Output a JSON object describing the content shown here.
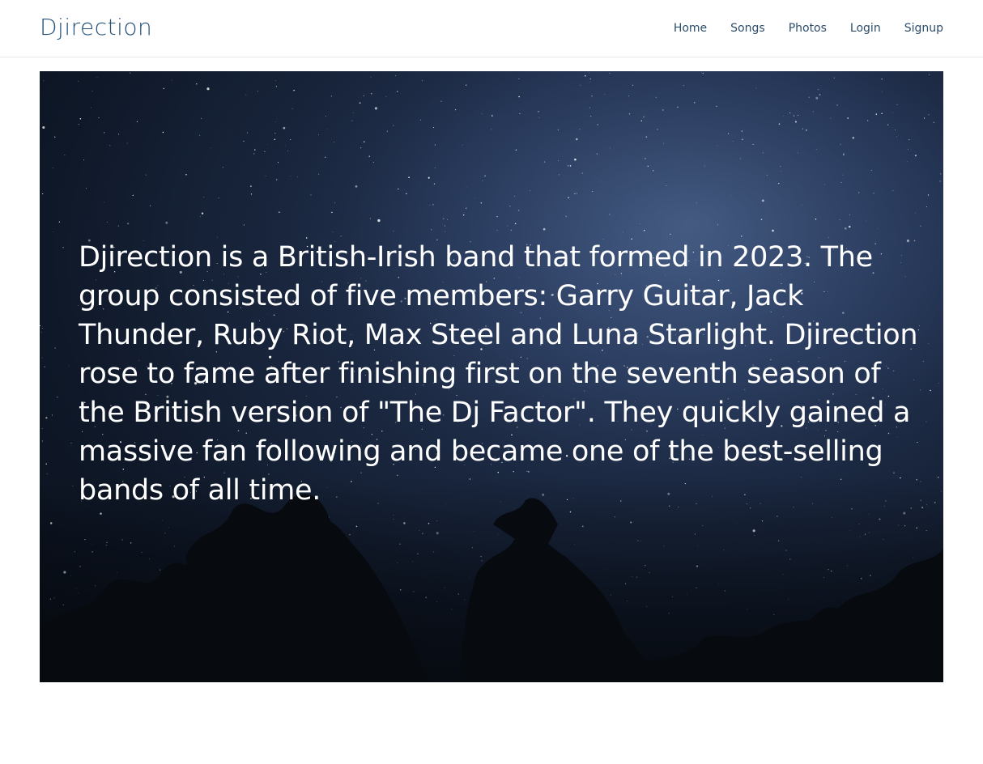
{
  "header": {
    "brand": "Djirection",
    "nav": [
      {
        "label": "Home"
      },
      {
        "label": "Songs"
      },
      {
        "label": "Photos"
      },
      {
        "label": "Login"
      },
      {
        "label": "Signup"
      }
    ]
  },
  "hero": {
    "paragraph": "Djirection is a British-Irish band that formed in 2023. The group consisted of five members: Garry Guitar, Jack Thunder, Ruby Riot, Max Steel and Luna Starlight. Djirection rose to fame after finishing first on the seventh season of the British version of \"The Dj Factor\". They quickly gained a massive fan following and became one of the best-selling bands of all time.",
    "background": "starry-night-sky-with-tree-silhouettes"
  },
  "colors": {
    "brand": "#25517a",
    "nav_link": "#2c4d6b",
    "hero_text": "#ffffff"
  }
}
